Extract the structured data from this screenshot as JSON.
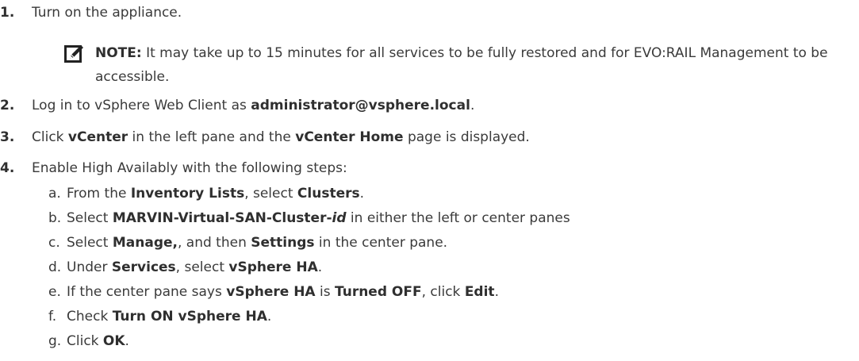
{
  "steps": [
    {
      "num": "1.",
      "parts": [
        "Turn on the appliance."
      ]
    },
    {
      "num": "2.",
      "parts": [
        "Log in to vSphere Web Client as ",
        "administrator@vsphere.local",
        "."
      ]
    },
    {
      "num": "3.",
      "parts": [
        "Click ",
        "vCenter",
        " in the left pane and the ",
        "vCenter Home",
        " page is displayed."
      ]
    },
    {
      "num": "4.",
      "parts": [
        "Enable High Availably with the following steps:"
      ]
    }
  ],
  "note": {
    "label": "NOTE:",
    "text": " It may take up to 15 minutes for all services to be fully restored and for EVO:RAIL Management to be accessible."
  },
  "substeps": [
    {
      "letter": "a.",
      "parts": [
        "From the ",
        "Inventory Lists",
        ", select ",
        "Clusters",
        "."
      ]
    },
    {
      "letter": "b.",
      "parts": [
        "Select ",
        "MARVIN-Virtual-SAN-Cluster-",
        "id",
        " in either the left or center panes"
      ]
    },
    {
      "letter": "c.",
      "parts": [
        "Select ",
        "Manage,",
        ", and then ",
        "Settings",
        " in the center pane."
      ]
    },
    {
      "letter": "d.",
      "parts": [
        "Under ",
        "Services",
        ", select ",
        "vSphere HA",
        "."
      ]
    },
    {
      "letter": "e.",
      "parts": [
        "If the center pane says ",
        "vSphere HA",
        " is ",
        "Turned OFF",
        ", click ",
        "Edit",
        "."
      ]
    },
    {
      "letter": "f.",
      "parts": [
        "Check ",
        "Turn ON vSphere HA",
        "."
      ]
    },
    {
      "letter": "g.",
      "parts": [
        "Click ",
        "OK",
        "."
      ]
    }
  ]
}
